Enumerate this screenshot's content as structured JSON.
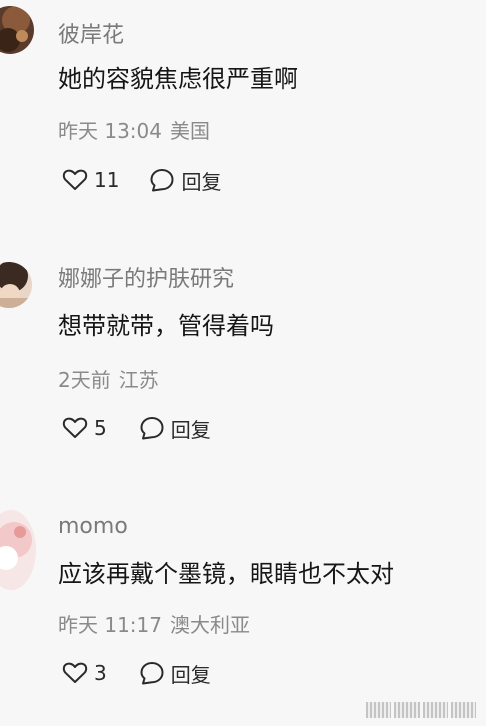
{
  "comments": [
    {
      "username": "彼岸花",
      "content": "她的容貌焦虑很严重啊",
      "time": "昨天 13:04",
      "location": "美国",
      "likes": "11",
      "reply_label": "回复"
    },
    {
      "username": "娜娜子的护肤研究",
      "content": "想带就带，管得着吗",
      "time": "2天前",
      "location": "江苏",
      "likes": "5",
      "reply_label": "回复"
    },
    {
      "username": "momo",
      "content": "应该再戴个墨镜，眼睛也不太对",
      "time": "昨天 11:17",
      "location": "澳大利亚",
      "likes": "3",
      "reply_label": "回复"
    }
  ],
  "icons": {
    "like": "heart-outline-icon",
    "reply": "speech-bubble-icon"
  },
  "colors": {
    "background": "#f7f7f8",
    "username": "#7a7a7a",
    "content": "#161616",
    "meta": "#8a8a8a"
  }
}
